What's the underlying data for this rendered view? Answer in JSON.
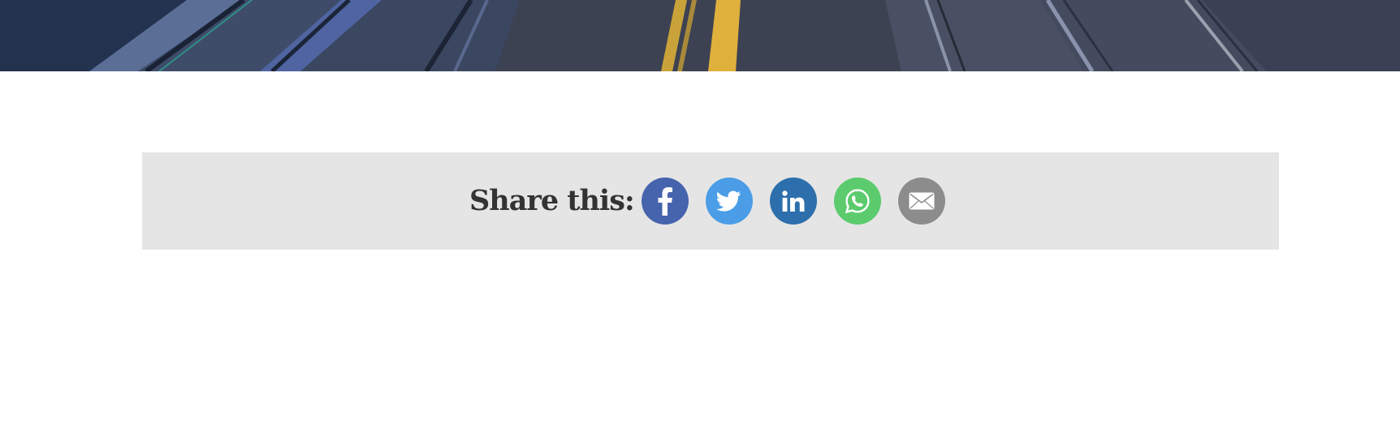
{
  "hero": {
    "image_description_icon": "road-photo"
  },
  "share": {
    "label": "Share this:",
    "buttons": [
      {
        "id": "facebook",
        "icon": "facebook-icon",
        "color": "#4664ad"
      },
      {
        "id": "twitter",
        "icon": "twitter-icon",
        "color": "#4a9de6"
      },
      {
        "id": "linkedin",
        "icon": "linkedin-icon",
        "color": "#2d6fac"
      },
      {
        "id": "whatsapp",
        "icon": "whatsapp-icon",
        "color": "#5ccb6d"
      },
      {
        "id": "email",
        "icon": "email-icon",
        "color": "#8c8c8c"
      }
    ]
  }
}
